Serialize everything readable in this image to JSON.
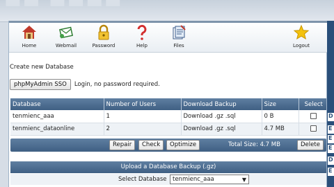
{
  "nav": {
    "items": [
      {
        "label": "Home",
        "icon": "home-icon"
      },
      {
        "label": "Webmail",
        "icon": "webmail-icon"
      },
      {
        "label": "Password",
        "icon": "lock-icon"
      },
      {
        "label": "Help",
        "icon": "help-icon"
      },
      {
        "label": "Files",
        "icon": "files-icon"
      },
      {
        "label": "Logout",
        "icon": "star-icon"
      }
    ]
  },
  "create_db_label": "Create new Database",
  "sso": {
    "button_label": "phpMyAdmin SSO",
    "text": "Login, no password required."
  },
  "table": {
    "headers": [
      "Database",
      "Number of Users",
      "Download Backup",
      "Size",
      "Select"
    ],
    "rows": [
      {
        "database": "tenmienc_aaa",
        "users": "1",
        "download": "Download .gz .sql",
        "size": "0 B"
      },
      {
        "database": "tenmienc_dataonline",
        "users": "2",
        "download": "Download .gz .sql",
        "size": "4.7 MB"
      }
    ]
  },
  "actions": {
    "repair": "Repair",
    "check": "Check",
    "optimize": "Optimize",
    "total_size": "Total Size: 4.7 MB",
    "delete": "Delete"
  },
  "upload": {
    "header": "Upload a Database Backup (.gz)",
    "select_label": "Select Database",
    "selected": "tenmienc_aaa"
  },
  "right_strip": [
    "D",
    "E",
    "E",
    "E",
    "D",
    "E"
  ],
  "colors": {
    "header_blue": "#4a6a8f",
    "nav_border": "#7e94ab"
  }
}
